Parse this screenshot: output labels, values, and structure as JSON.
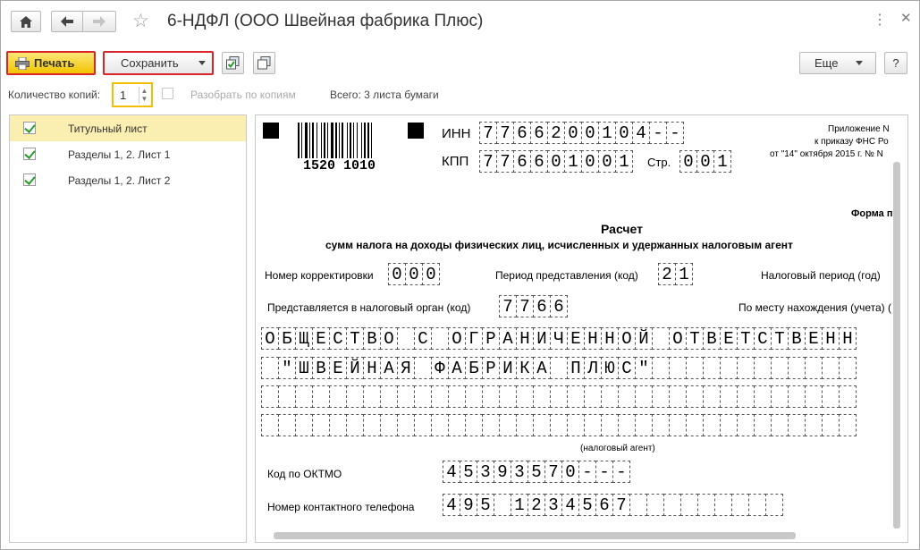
{
  "window": {
    "title": "6-НДФЛ (ООО Швейная фабрика Плюс)",
    "icons": {
      "home": "home-icon",
      "back": "arrow-left-icon",
      "forward": "arrow-right-icon",
      "favorite": "star-icon",
      "more": "more-icon",
      "close": "close-icon"
    }
  },
  "toolbar": {
    "print_label": "Печать",
    "save_label": "Сохранить",
    "more_label": "Еще",
    "help_label": "?"
  },
  "copies": {
    "label": "Количество копий:",
    "value": "1",
    "collate_label": "Разобрать по копиям",
    "total_label": "Всего: 3 листа бумаги"
  },
  "sheets": [
    {
      "label": "Титульный лист",
      "checked": true,
      "selected": true
    },
    {
      "label": "Разделы 1, 2. Лист 1",
      "checked": true,
      "selected": false
    },
    {
      "label": "Разделы 1, 2. Лист 2",
      "checked": true,
      "selected": false
    }
  ],
  "document": {
    "barcode_number": "1520  1010",
    "inn_label": "ИНН",
    "inn_cells": [
      "7",
      "7",
      "6",
      "6",
      "2",
      "0",
      "0",
      "1",
      "0",
      "4",
      "-",
      "-"
    ],
    "kpp_label": "КПП",
    "kpp_cells": [
      "7",
      "7",
      "6",
      "6",
      "0",
      "1",
      "0",
      "0",
      "1"
    ],
    "page_label": "Стр.",
    "page_cells": [
      "0",
      "0",
      "1"
    ],
    "appendix_line1": "Приложение N",
    "appendix_line2": "к приказу ФНС Ро",
    "appendix_line3": "от \"14\" октября 2015 г. № N",
    "form_label": "Форма п",
    "title": "Расчет",
    "subtitle": "сумм налога на доходы физических лиц, исчисленных и удержанных налоговым агент",
    "correction_label": "Номер корректировки",
    "correction_cells": [
      "0",
      "0",
      "0"
    ],
    "period_label": "Период представления (код)",
    "period_cells": [
      "2",
      "1"
    ],
    "tax_period_label": "Налоговый период (год)",
    "authority_label": "Представляется в налоговый орган (код)",
    "authority_cells": [
      "7",
      "7",
      "6",
      "6"
    ],
    "location_label": "По месту нахождения (учета) (",
    "name_row1": [
      "О",
      "Б",
      "Щ",
      "Е",
      "С",
      "Т",
      "В",
      "О",
      " ",
      "С",
      " ",
      "О",
      "Г",
      "Р",
      "А",
      "Н",
      "И",
      "Ч",
      "Е",
      "Н",
      "Н",
      "О",
      "Й",
      " ",
      "О",
      "Т",
      "В",
      "Е",
      "Т",
      "С",
      "Т",
      "В",
      "Е",
      "Н",
      "Н"
    ],
    "name_row2": [
      " ",
      "\"",
      "Ш",
      "В",
      "Е",
      "Й",
      "Н",
      "А",
      "Я",
      " ",
      "Ф",
      "А",
      "Б",
      "Р",
      "И",
      "К",
      "А",
      " ",
      "П",
      "Л",
      "Ю",
      "С",
      "\"",
      " ",
      " ",
      " ",
      " ",
      " ",
      " ",
      " ",
      " ",
      " ",
      " ",
      " ",
      " "
    ],
    "agent_caption": "(налоговый агент)",
    "oktmo_label": "Код по ОКТМО",
    "oktmo_cells": [
      "4",
      "5",
      "3",
      "9",
      "3",
      "5",
      "7",
      "0",
      "-",
      "-",
      "-"
    ],
    "phone_label": "Номер контактного телефона",
    "phone_cells": [
      "4",
      "9",
      "5",
      " ",
      "1",
      "2",
      "3",
      "4",
      "5",
      "6",
      "7",
      " ",
      " ",
      " ",
      " ",
      " ",
      " ",
      " ",
      " ",
      " "
    ]
  },
  "colors": {
    "accent_yellow": "#f2c500",
    "highlight_red": "#d9242a",
    "selected_row": "#faeeb0",
    "check_green": "#2b9a2b"
  }
}
